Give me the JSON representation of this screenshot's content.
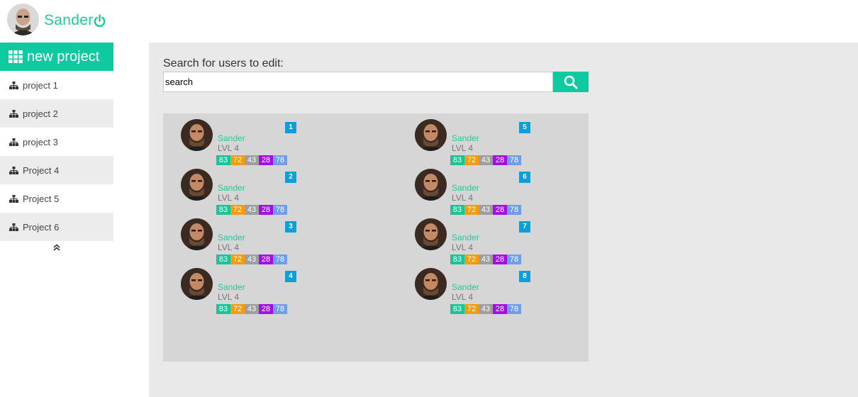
{
  "header": {
    "username": "Sander",
    "avatar_icon": "user-avatar",
    "power_icon": "power-icon"
  },
  "sidebar": {
    "new_project_label": "new project",
    "items": [
      {
        "label": "project 1"
      },
      {
        "label": "project 2"
      },
      {
        "label": "project 3"
      },
      {
        "label": "Project 4"
      },
      {
        "label": "Project 5"
      },
      {
        "label": "Project 6"
      }
    ]
  },
  "search": {
    "label": "Search for users to edit:",
    "value": "search"
  },
  "users": [
    {
      "number": "1",
      "name": "Sander",
      "level": "LVL 4",
      "stats": [
        "83",
        "72",
        "43",
        "28",
        "78"
      ]
    },
    {
      "number": "2",
      "name": "Sander",
      "level": "LVL 4",
      "stats": [
        "83",
        "72",
        "43",
        "28",
        "78"
      ]
    },
    {
      "number": "3",
      "name": "Sander",
      "level": "LVL 4",
      "stats": [
        "83",
        "72",
        "43",
        "28",
        "78"
      ]
    },
    {
      "number": "4",
      "name": "Sander",
      "level": "LVL 4",
      "stats": [
        "83",
        "72",
        "43",
        "28",
        "78"
      ]
    },
    {
      "number": "5",
      "name": "Sander",
      "level": "LVL 4",
      "stats": [
        "83",
        "72",
        "43",
        "28",
        "78"
      ]
    },
    {
      "number": "6",
      "name": "Sander",
      "level": "LVL 4",
      "stats": [
        "83",
        "72",
        "43",
        "28",
        "78"
      ]
    },
    {
      "number": "7",
      "name": "Sander",
      "level": "LVL 4",
      "stats": [
        "83",
        "72",
        "43",
        "28",
        "78"
      ]
    },
    {
      "number": "8",
      "name": "Sander",
      "level": "LVL 4",
      "stats": [
        "83",
        "72",
        "43",
        "28",
        "78"
      ]
    }
  ],
  "colors": {
    "accent": "#0fcaa0",
    "badge": "#0c9fd8",
    "stat_colors": [
      "#19c496",
      "#f39c12",
      "#9e9e9e",
      "#a20ee8",
      "#6f9de8"
    ]
  }
}
